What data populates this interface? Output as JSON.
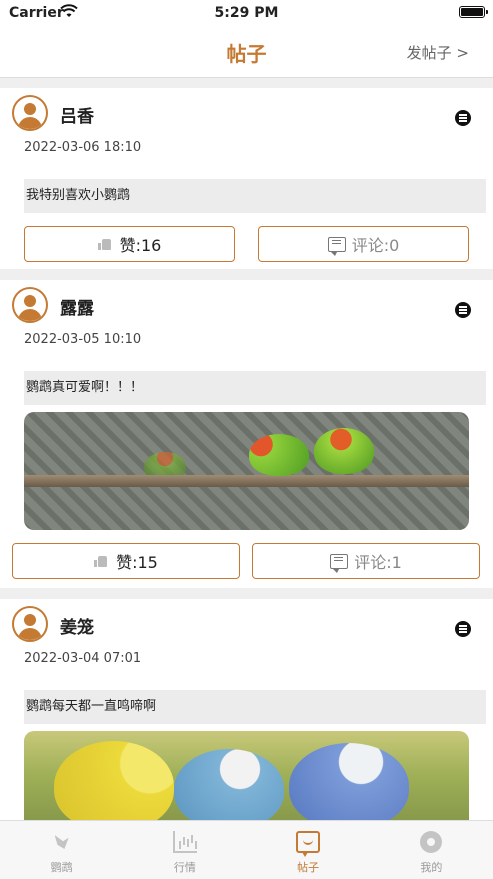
{
  "status_bar": {
    "carrier": "Carrier",
    "time": "5:29 PM"
  },
  "nav": {
    "title": "帖子",
    "post_button": "发帖子 >"
  },
  "posts": [
    {
      "user": "吕香",
      "date": "2022-03-06 18:10",
      "content": "我特别喜欢小鹦鹉",
      "likes": "赞:16",
      "comments": "评论:0",
      "has_image": false
    },
    {
      "user": "露露",
      "date": "2022-03-05 10:10",
      "content": "鹦鹉真可爱啊！！！",
      "likes": "赞:15",
      "comments": "评论:1",
      "has_image": true
    },
    {
      "user": "姜笼",
      "date": "2022-03-04 07:01",
      "content": "鹦鹉每天都一直鸣啼啊",
      "has_image": true
    }
  ],
  "tabs": [
    {
      "label": "鹦鹉",
      "icon": "parrot-icon",
      "active": false
    },
    {
      "label": "行情",
      "icon": "chart-icon",
      "active": false
    },
    {
      "label": "帖子",
      "icon": "post-icon",
      "active": true
    },
    {
      "label": "我的",
      "icon": "gear-icon",
      "active": false
    }
  ],
  "colors": {
    "accent": "#c47a33",
    "background": "#efefef",
    "inactive": "#999999"
  }
}
